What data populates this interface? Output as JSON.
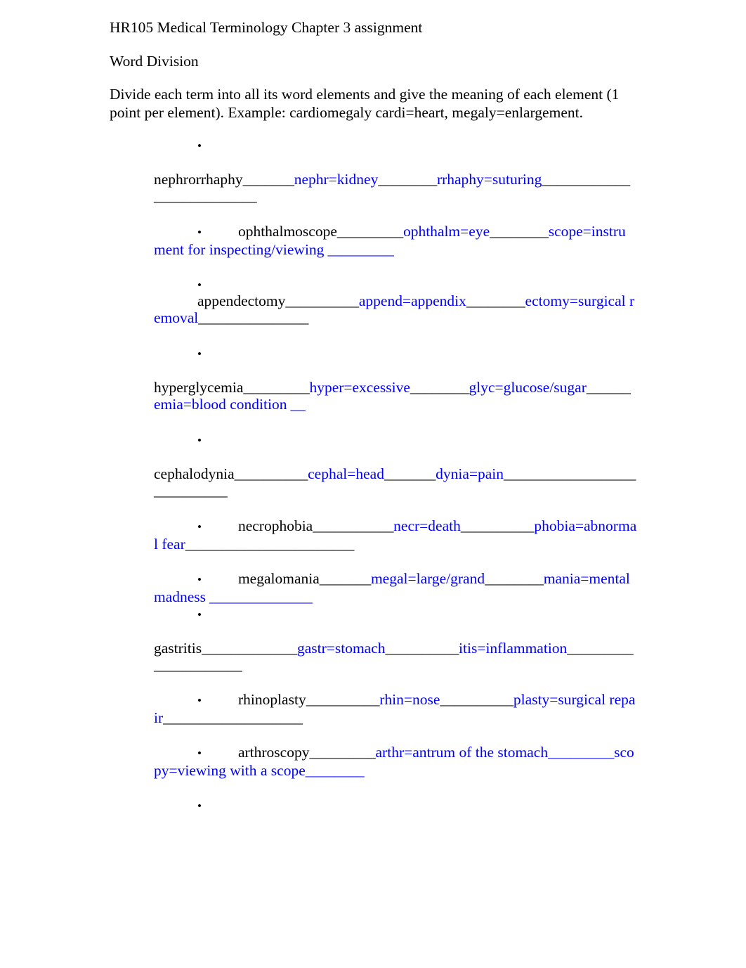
{
  "document": {
    "title_line": "HR105  Medical Terminology Chapter 3 assignment",
    "section_heading": "Word Division",
    "instructions_line1": "Divide each term into all its word elements and give the meaning of each element (1",
    "instructions_line2": "point per element).  Example:  cardiomegaly  cardi=heart, megaly=enlargement.",
    "bullet_glyph": "•",
    "answer_color": "#0000FF",
    "question_color": "#000000"
  },
  "items": [
    {
      "id": "nephrorrhaphy",
      "layout": "bullet-own-line",
      "term": "nephrorrhaphy",
      "rule1": "_______",
      "answer1": "nephr=kidney",
      "rule2": "________",
      "answer2": "rrhaphy=suturing",
      "rule3": "_________________",
      "rule_wrap": "_________"
    },
    {
      "id": "ophthalmoscope",
      "layout": "bullet-inline",
      "term": "ophthalmoscope",
      "rule1": "_________",
      "answer1": "ophthalm=eye",
      "rule2": "________",
      "answer2": "scope=instrument for inspecting/viewing",
      "rule3": " _________"
    },
    {
      "id": "appendectomy",
      "layout": "bullet-own-line",
      "term": "appendectomy",
      "indent_term": true,
      "rule1": "__________",
      "answer1": "append=appendix",
      "rule2": "________",
      "answer2": "ectomy=surgical removal",
      "rule3": "_______________"
    },
    {
      "id": "hyperglycemia",
      "layout": "bullet-own-line",
      "term": "hyperglycemia",
      "rule1": "_________",
      "answer1": "hyper=excessive",
      "rule2": "________",
      "answer2": "glyc=glucose/sugar",
      "rule3": "______",
      "answer3": "emia=blood condition",
      "rule4": " __"
    },
    {
      "id": "cephalodynia",
      "layout": "bullet-own-line",
      "term": "cephalodynia",
      "rule1": "__________",
      "answer1": "cephal=head",
      "rule2": "_______",
      "answer2": "dynia=pain",
      "rule3": "___________________",
      "rule_wrap": "_________"
    },
    {
      "id": "necrophobia",
      "layout": "bullet-inline",
      "term": "necrophobia",
      "rule1": "___________",
      "answer1": "necr=death",
      "rule2": "__________",
      "answer2": "phobia=abnormal fear",
      "rule3": "_______________________"
    },
    {
      "id": "megalomania",
      "layout": "bullet-inline",
      "term": "megalomania",
      "rule1": "_______",
      "answer1": "megal=large/grand",
      "rule2": "________",
      "answer2": "mania=mental madness",
      "rule3": " ______________"
    },
    {
      "id": "gastritis",
      "layout": "bullet-own-line",
      "term": "gastritis",
      "rule1": "_____________",
      "answer1": "gastr=stomach",
      "rule2": "__________",
      "answer2": "itis=inflammation",
      "rule3": "___________",
      "rule_wrap": "__________"
    },
    {
      "id": "rhinoplasty",
      "layout": "bullet-inline",
      "term": "rhinoplasty",
      "rule1": "__________",
      "answer1": "rhin=nose",
      "rule2": "__________",
      "answer2": "plasty=surgical repair",
      "rule3": "___________________"
    },
    {
      "id": "arthroscopy",
      "layout": "bullet-inline",
      "term": "arthroscopy",
      "rule1": "_________",
      "answer1": "arthr=antrum of the stomach",
      "rule2": "_________",
      "answer2": "scopy=viewing with a scope",
      "rule3": "________"
    },
    {
      "id": "empty-final",
      "layout": "bullet-only",
      "term": "",
      "rule1": "",
      "answer1": "",
      "rule2": "",
      "answer2": "",
      "rule3": ""
    }
  ]
}
